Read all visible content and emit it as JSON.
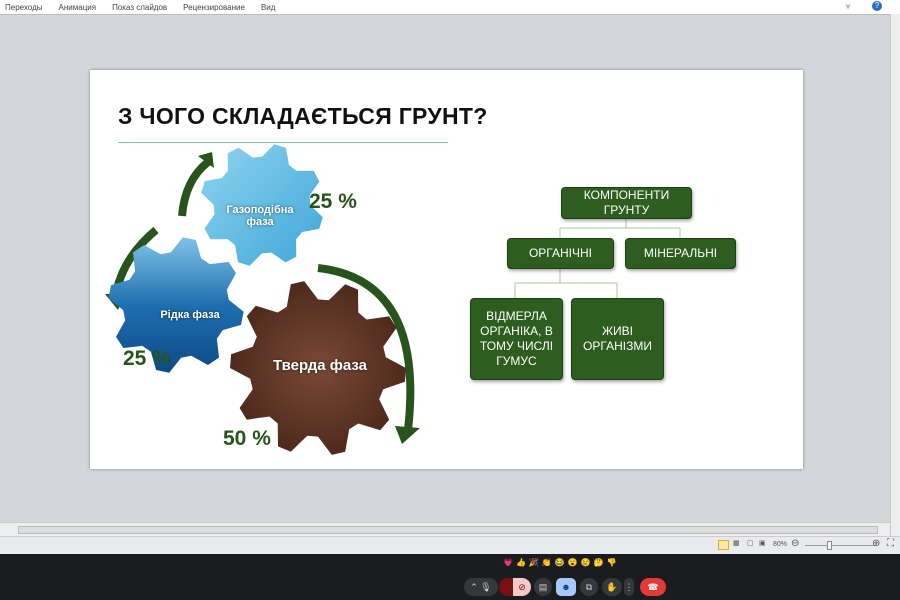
{
  "menu": [
    "Переходы",
    "Анимация",
    "Показ слайдов",
    "Рецензирование",
    "Вид"
  ],
  "slide": {
    "title": "З ЧОГО СКЛАДАЄТЬСЯ ГРУНТ?",
    "gears": {
      "gas": "Газоподібна фаза",
      "liquid": "Рідка фаза",
      "solid": "Тверда фаза"
    },
    "percents": {
      "gas": "25 %",
      "liquid": "25 %",
      "solid": "50 %"
    },
    "chart": {
      "root": "КОМПОНЕНТИ ГРУНТУ",
      "organic": "ОРГАНІЧНІ",
      "mineral": "МІНЕРАЛЬНІ",
      "dead": "ВІДМЕРЛА ОРГАНІКА, В ТОМУ ЧИСЛІ ГУМУС",
      "alive": "ЖИВІ ОРГАНІЗМИ"
    }
  },
  "status": {
    "zoom": "80%"
  },
  "reactions": "💗👍🎉👏😂😮😢🤔👎",
  "colors": {
    "green": "#2d5e1f",
    "end_call": "#e53935"
  }
}
